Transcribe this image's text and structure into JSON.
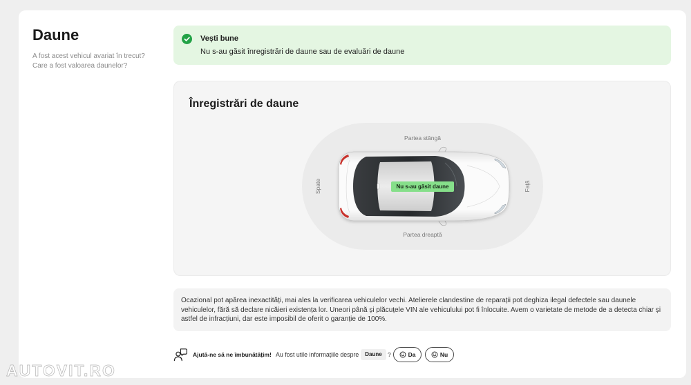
{
  "section": {
    "title": "Daune",
    "subtitle": "A fost acest vehicul avariat în trecut? Care a fost valoarea daunelor?"
  },
  "alert": {
    "icon": "check-circle-icon",
    "title": "Vești bune",
    "message": "Nu s-au găsit înregistrări de daune sau de evaluări de daune"
  },
  "records": {
    "title": "Înregistrări de daune",
    "diagram": {
      "label_top": "Partea stângă",
      "label_bottom": "Partea dreaptă",
      "label_rear": "Spate",
      "label_front": "Față",
      "vehicle_icon": "car-top-view",
      "status_badge": "Nu s-au găsit daune"
    }
  },
  "disclaimer": {
    "lines": [
      "Ocazional pot apărea inexactități, mai ales la verificarea vehiculelor vechi. Atelierele clandestine de reparații pot deghiza ilegal defectele sau daunele",
      "vehiculelor, fără să declare nicăieri existența lor. Uneori până și plăcuțele VIN ale vehiculului pot fi înlocuite. Avem o varietate de metode de a detecta chiar și",
      "astfel de infracțiuni, dar este imposibil de oferit o garanție de 100%."
    ]
  },
  "feedback": {
    "icon": "feedback-person-icon",
    "prompt": "Ajută-ne să ne îmbunătățim!",
    "question": "Au fost utile informațiile despre",
    "topic": "Daune",
    "question_mark": "?",
    "yes_label": "Da",
    "no_label": "Nu",
    "button_icon": "smiley-icon"
  },
  "watermark": "AUTOVIT.RO",
  "colors": {
    "success": "#22a246",
    "alert_background": "#e4f6e2",
    "badge_background": "#86df8a",
    "panel_background": "#f5f5f5",
    "page_background": "#efefef"
  }
}
